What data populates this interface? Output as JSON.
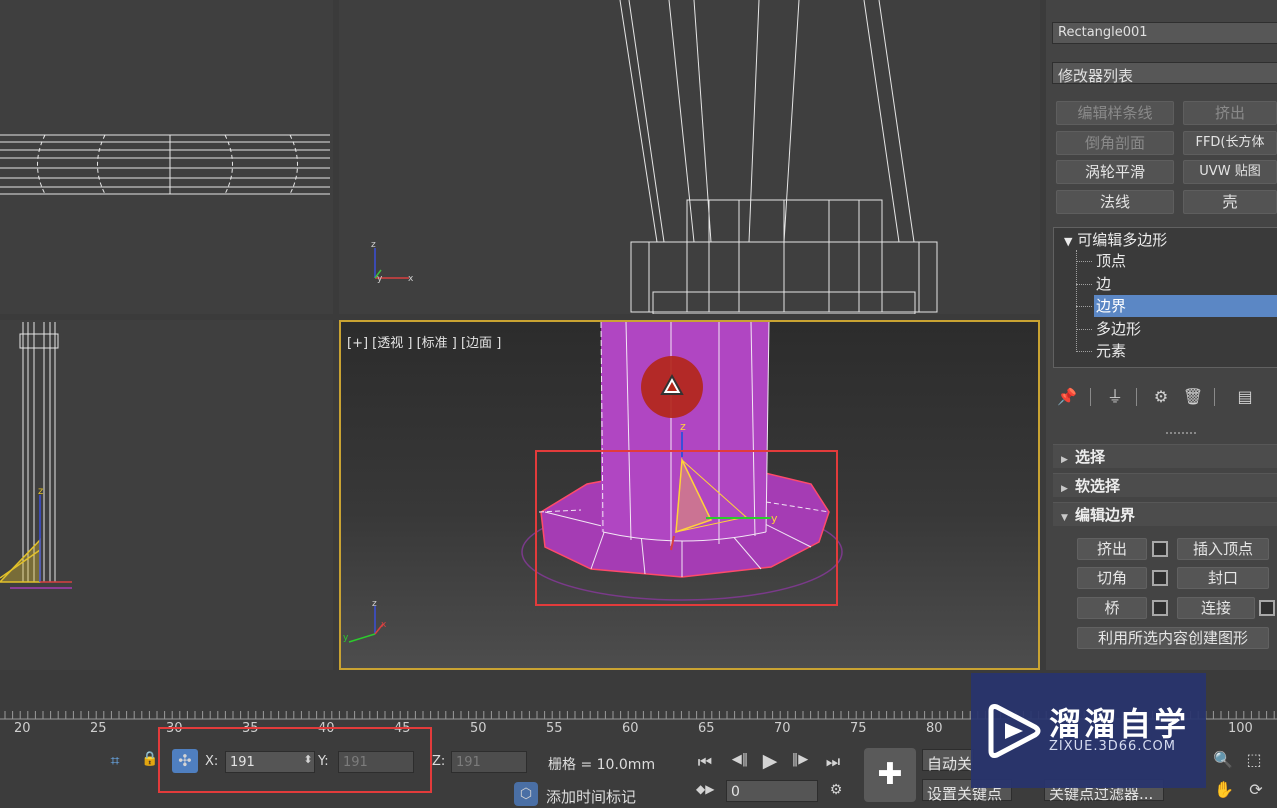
{
  "viewports": {
    "perspective_label": "[+] [透视 ] [标准 ] [边面 ]"
  },
  "axis": {
    "z": "z",
    "y": "y",
    "x": "x"
  },
  "command_panel": {
    "object_name": "Rectangle001",
    "modifier_list": "修改器列表",
    "modifier_buttons": [
      {
        "label": "编辑样条线"
      },
      {
        "label": "挤出"
      },
      {
        "label": "倒角剖面"
      },
      {
        "label": "FFD(长方体"
      },
      {
        "label": "涡轮平滑"
      },
      {
        "label": "UVW 贴图"
      },
      {
        "label": "法线"
      },
      {
        "label": "壳"
      }
    ],
    "stack": {
      "root": "可编辑多边形",
      "root_arrow": "▼",
      "items": [
        {
          "label": "顶点"
        },
        {
          "label": "边"
        },
        {
          "label": "边界"
        },
        {
          "label": "多边形"
        },
        {
          "label": "元素"
        }
      ]
    },
    "tools": {
      "pin": "📌",
      "show_end": "⏚",
      "unique": "⚙",
      "remove": "🗑",
      "configure": "▤"
    },
    "rollouts": {
      "select": "选择",
      "soft_select": "软选择",
      "edit_border": "编辑边界",
      "collapsed_arrow": "▶",
      "open_arrow": "▼"
    },
    "edit_border_buttons": {
      "extrude": "挤出",
      "insert_vertex": "插入顶点",
      "chamfer": "切角",
      "cap": "封口",
      "bridge": "桥",
      "connect": "连接",
      "create_shape": "利用所选内容创建图形"
    }
  },
  "timeline": {
    "ticks": [
      "20",
      "25",
      "30",
      "35",
      "40",
      "45",
      "50",
      "55",
      "60",
      "65",
      "70",
      "75",
      "80",
      "100"
    ]
  },
  "status": {
    "x_label": "X:",
    "x_value": "191",
    "y_label": "Y:",
    "y_value": "191",
    "z_label": "Z:",
    "z_value": "191",
    "grid": "栅格 = 10.0mm",
    "add_time_tag": "添加时间标记",
    "auto_key": "自动关",
    "set_key": "设置关键点",
    "key_filter": "关键点过滤器...",
    "frame_value": "0",
    "icons": {
      "isolate": "⌗",
      "lock": "🔒",
      "transform_mode": "✣",
      "goto_start": "⏮",
      "prev_frame": "◀‖",
      "play": "▶",
      "next_frame": "‖▶",
      "goto_end": "⏭",
      "set_key_big": "✚",
      "spinner": "⬍",
      "zoom": "🔍",
      "pan": "✋",
      "orbit": "⟳"
    }
  },
  "watermark": {
    "title": "溜溜自学",
    "url": "ZIXUE.3D66.COM"
  },
  "colors": {
    "viewport_active_border": "#c9a332",
    "selection_blue": "#5b87c5",
    "object_purple": "#a53cb4",
    "highlight_red": "#e23b3b"
  }
}
